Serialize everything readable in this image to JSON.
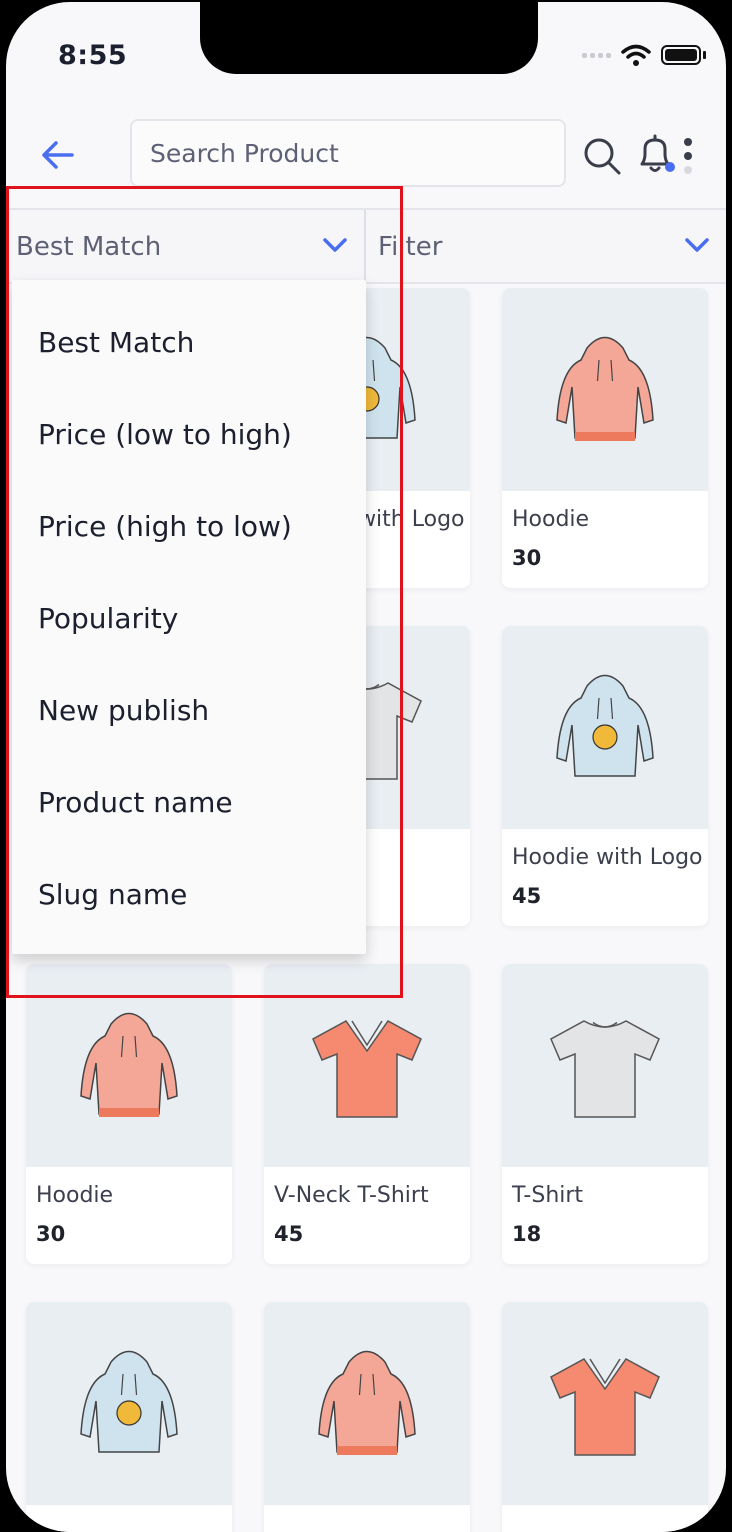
{
  "status_bar": {
    "time": "8:55"
  },
  "header": {
    "search_placeholder": "Search Product"
  },
  "sort": {
    "selected": "Best Match",
    "filter_label": "Filter"
  },
  "dropdown_options": [
    "Best Match",
    "Price (low to high)",
    "Price (high to low)",
    "Popularity",
    "New publish",
    "Product name",
    "Slug name"
  ],
  "products": [
    {
      "name": "Hoodie with Logo",
      "price": "",
      "icon": "blue-hoodie"
    },
    {
      "name": "Hoodie with Logo",
      "price": "",
      "icon": "blue-hoodie"
    },
    {
      "name": "Hoodie",
      "price": "30",
      "icon": "pink-hoodie"
    },
    {
      "name": "",
      "price": "",
      "icon": "grey-tshirt"
    },
    {
      "name": "",
      "price": "",
      "icon": "grey-tshirt"
    },
    {
      "name": "Hoodie with Logo",
      "price": "45",
      "icon": "blue-hoodie"
    },
    {
      "name": "Hoodie",
      "price": "30",
      "icon": "pink-hoodie"
    },
    {
      "name": "V-Neck T-Shirt",
      "price": "45",
      "icon": "orange-vneck"
    },
    {
      "name": "T-Shirt",
      "price": "18",
      "icon": "grey-tshirt"
    },
    {
      "name": "",
      "price": "",
      "icon": "blue-hoodie"
    },
    {
      "name": "",
      "price": "",
      "icon": "pink-hoodie"
    },
    {
      "name": "",
      "price": "",
      "icon": "orange-vneck"
    }
  ],
  "colors": {
    "accent": "#4a6ef0",
    "highlight": "#e0121c"
  }
}
